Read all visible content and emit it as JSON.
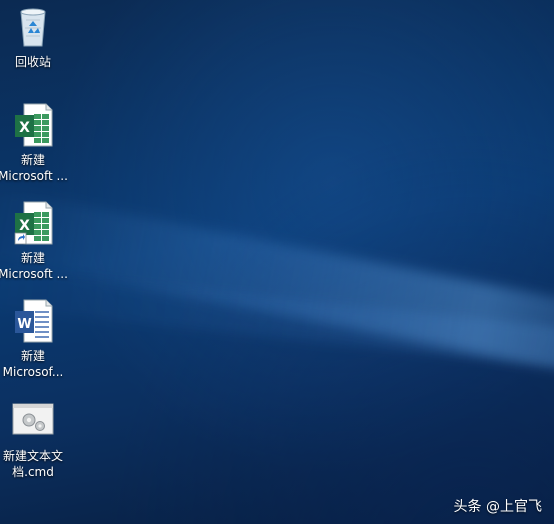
{
  "desktop": {
    "icons": [
      {
        "label": "回收站",
        "type": "recycle-bin"
      },
      {
        "label_line1": "新建",
        "label_line2": "Microsoft ...",
        "type": "excel"
      },
      {
        "label_line1": "新建",
        "label_line2": "Microsoft ...",
        "type": "excel-shortcut"
      },
      {
        "label_line1": "新建",
        "label_line2": "Microsof...",
        "type": "word"
      },
      {
        "label_line1": "新建文本文",
        "label_line2": "档.cmd",
        "type": "cmd-file"
      }
    ]
  },
  "watermark": {
    "text": "头条 @上官飞"
  },
  "colors": {
    "excel_green": "#1e7145",
    "word_blue": "#2b579a",
    "desktop_bg": "#0a3a72"
  }
}
